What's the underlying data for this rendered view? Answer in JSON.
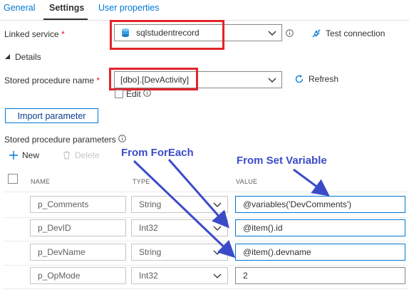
{
  "tabs": [
    {
      "label": "General"
    },
    {
      "label": "Settings"
    },
    {
      "label": "User properties"
    }
  ],
  "linked_service": {
    "label": "Linked service",
    "required_mark": "*",
    "value": "sqlstudentrecord",
    "test_connection": "Test connection"
  },
  "details": {
    "label": "Details"
  },
  "stored_procedure": {
    "label": "Stored procedure name",
    "required_mark": "*",
    "value": "[dbo].[DevActivity]",
    "refresh": "Refresh",
    "edit": "Edit"
  },
  "import_parameter": "Import parameter",
  "params": {
    "title": "Stored procedure parameters",
    "new_label": "New",
    "delete_label": "Delete",
    "columns": {
      "name": "NAME",
      "type": "TYPE",
      "value": "VALUE"
    },
    "rows": [
      {
        "name": "p_Comments",
        "type": "String",
        "value": "@variables('DevComments')"
      },
      {
        "name": "p_DevID",
        "type": "Int32",
        "value": "@item().id"
      },
      {
        "name": "p_DevName",
        "type": "String",
        "value": "@item().devname"
      },
      {
        "name": "p_OpMode",
        "type": "Int32",
        "value": "2"
      }
    ]
  },
  "annotations": {
    "foreach": "From ForEach",
    "set_variable": "From Set Variable"
  },
  "colors": {
    "accent": "#0078d4",
    "annotation": "#3b4bc8",
    "highlight_box": "#e3242b"
  }
}
